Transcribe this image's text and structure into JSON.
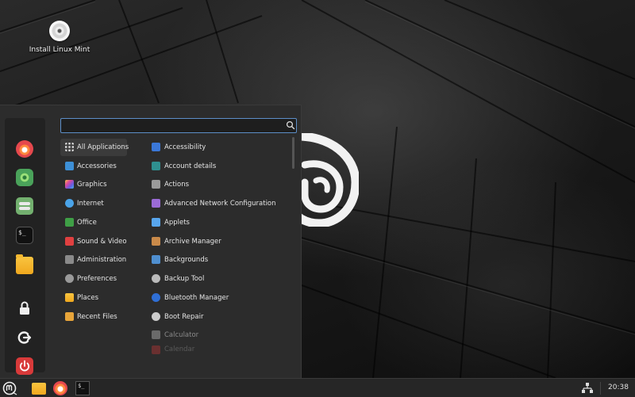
{
  "desktop": {
    "icons": [
      {
        "label": "Install Linux Mint",
        "icon": "disc-icon"
      }
    ]
  },
  "menu": {
    "search": {
      "value": "",
      "placeholder": ""
    },
    "favorites": [
      {
        "name": "firefox",
        "icon": "firefox-icon"
      },
      {
        "name": "software-manager",
        "icon": "software-manager-icon"
      },
      {
        "name": "system-settings",
        "icon": "settings-icon"
      },
      {
        "name": "terminal",
        "icon": "terminal-icon",
        "glyph": "$_"
      },
      {
        "name": "files",
        "icon": "folder-icon"
      },
      {
        "name": "lock-screen",
        "icon": "lock-icon"
      },
      {
        "name": "logout",
        "icon": "logout-icon"
      },
      {
        "name": "quit",
        "icon": "power-icon"
      }
    ],
    "categories": [
      {
        "label": "All Applications",
        "icon": "grid-icon",
        "color": "#e0e0e0"
      },
      {
        "label": "Accessories",
        "icon": "accessories-icon",
        "color": "#3d8fd6"
      },
      {
        "label": "Graphics",
        "icon": "graphics-icon",
        "color": "#d84fd0"
      },
      {
        "label": "Internet",
        "icon": "internet-icon",
        "color": "#4aa3e8"
      },
      {
        "label": "Office",
        "icon": "office-icon",
        "color": "#3f9f46"
      },
      {
        "label": "Sound & Video",
        "icon": "sound-video-icon",
        "color": "#e04040"
      },
      {
        "label": "Administration",
        "icon": "administration-icon",
        "color": "#8a8a8a"
      },
      {
        "label": "Preferences",
        "icon": "preferences-icon",
        "color": "#9a9a9a"
      },
      {
        "label": "Places",
        "icon": "places-icon",
        "color": "#f2b233"
      },
      {
        "label": "Recent Files",
        "icon": "recent-files-icon",
        "color": "#e8a53a"
      }
    ],
    "applications": [
      {
        "label": "Accessibility",
        "icon": "accessibility-icon",
        "color": "#3b78d8"
      },
      {
        "label": "Account details",
        "icon": "account-icon",
        "color": "#2f8f8f"
      },
      {
        "label": "Actions",
        "icon": "actions-icon",
        "color": "#9a9a9a"
      },
      {
        "label": "Advanced Network Configuration",
        "icon": "network-config-icon",
        "color": "#9b6bd6"
      },
      {
        "label": "Applets",
        "icon": "applets-icon",
        "color": "#58a6ee"
      },
      {
        "label": "Archive Manager",
        "icon": "archive-icon",
        "color": "#c98a4a"
      },
      {
        "label": "Backgrounds",
        "icon": "backgrounds-icon",
        "color": "#4f8fd0"
      },
      {
        "label": "Backup Tool",
        "icon": "backup-icon",
        "color": "#bbbbbb"
      },
      {
        "label": "Bluetooth Manager",
        "icon": "bluetooth-icon",
        "color": "#2f6fd6"
      },
      {
        "label": "Boot Repair",
        "icon": "boot-repair-icon",
        "color": "#cccccc"
      },
      {
        "label": "Calculator",
        "icon": "calculator-icon",
        "color": "#6a6a6a"
      },
      {
        "label": "Calendar",
        "icon": "calendar-icon",
        "color": "#6a3030"
      }
    ]
  },
  "taskbar": {
    "clock": "20:38",
    "terminal_glyph": "$_",
    "items": [
      {
        "name": "menu",
        "icon": "mint-menu-icon"
      },
      {
        "name": "files",
        "icon": "folder-icon"
      },
      {
        "name": "firefox",
        "icon": "firefox-icon"
      },
      {
        "name": "terminal",
        "icon": "terminal-icon"
      }
    ],
    "tray": [
      {
        "name": "network",
        "icon": "network-icon"
      }
    ]
  },
  "colors": {
    "menu_bg": "#2c2c2c",
    "favorites_bg": "#222222",
    "search_border": "#5d8fc8",
    "taskbar_bg": "#262626",
    "text": "#e4e4e4"
  }
}
